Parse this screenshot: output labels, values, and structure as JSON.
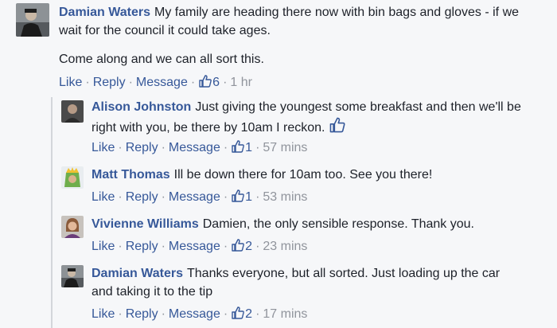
{
  "comments": [
    {
      "author": "Damian Waters",
      "text": "My family are heading there now with bin bags and gloves - if we wait for the council it could take ages.",
      "text2": "Come along and we can all sort this.",
      "like": "Like",
      "reply": "Reply",
      "message": "Message",
      "likes": "6",
      "time": "1 hr"
    },
    {
      "author": "Alison Johnston",
      "text": "Just giving the youngest some breakfast and then we'll be right with you, be there by 10am I reckon.",
      "like": "Like",
      "reply": "Reply",
      "message": "Message",
      "likes": "1",
      "time": "57 mins"
    },
    {
      "author": "Matt Thomas",
      "text": "Ill be down there for 10am too. See you there!",
      "like": "Like",
      "reply": "Reply",
      "message": "Message",
      "likes": "1",
      "time": "53 mins"
    },
    {
      "author": "Vivienne Williams",
      "text": "Damien, the only sensible response. Thank you.",
      "like": "Like",
      "reply": "Reply",
      "message": "Message",
      "likes": "2",
      "time": "23 mins"
    },
    {
      "author": "Damian Waters",
      "text": "Thanks everyone, but all sorted. Just loading up the car and taking it to the tip",
      "like": "Like",
      "reply": "Reply",
      "message": "Message",
      "likes": "2",
      "time": "17 mins"
    }
  ],
  "icons": {
    "like": "thumbs-up-icon"
  },
  "colors": {
    "link": "#365899",
    "meta": "#90949c",
    "background": "#f6f7f9"
  }
}
